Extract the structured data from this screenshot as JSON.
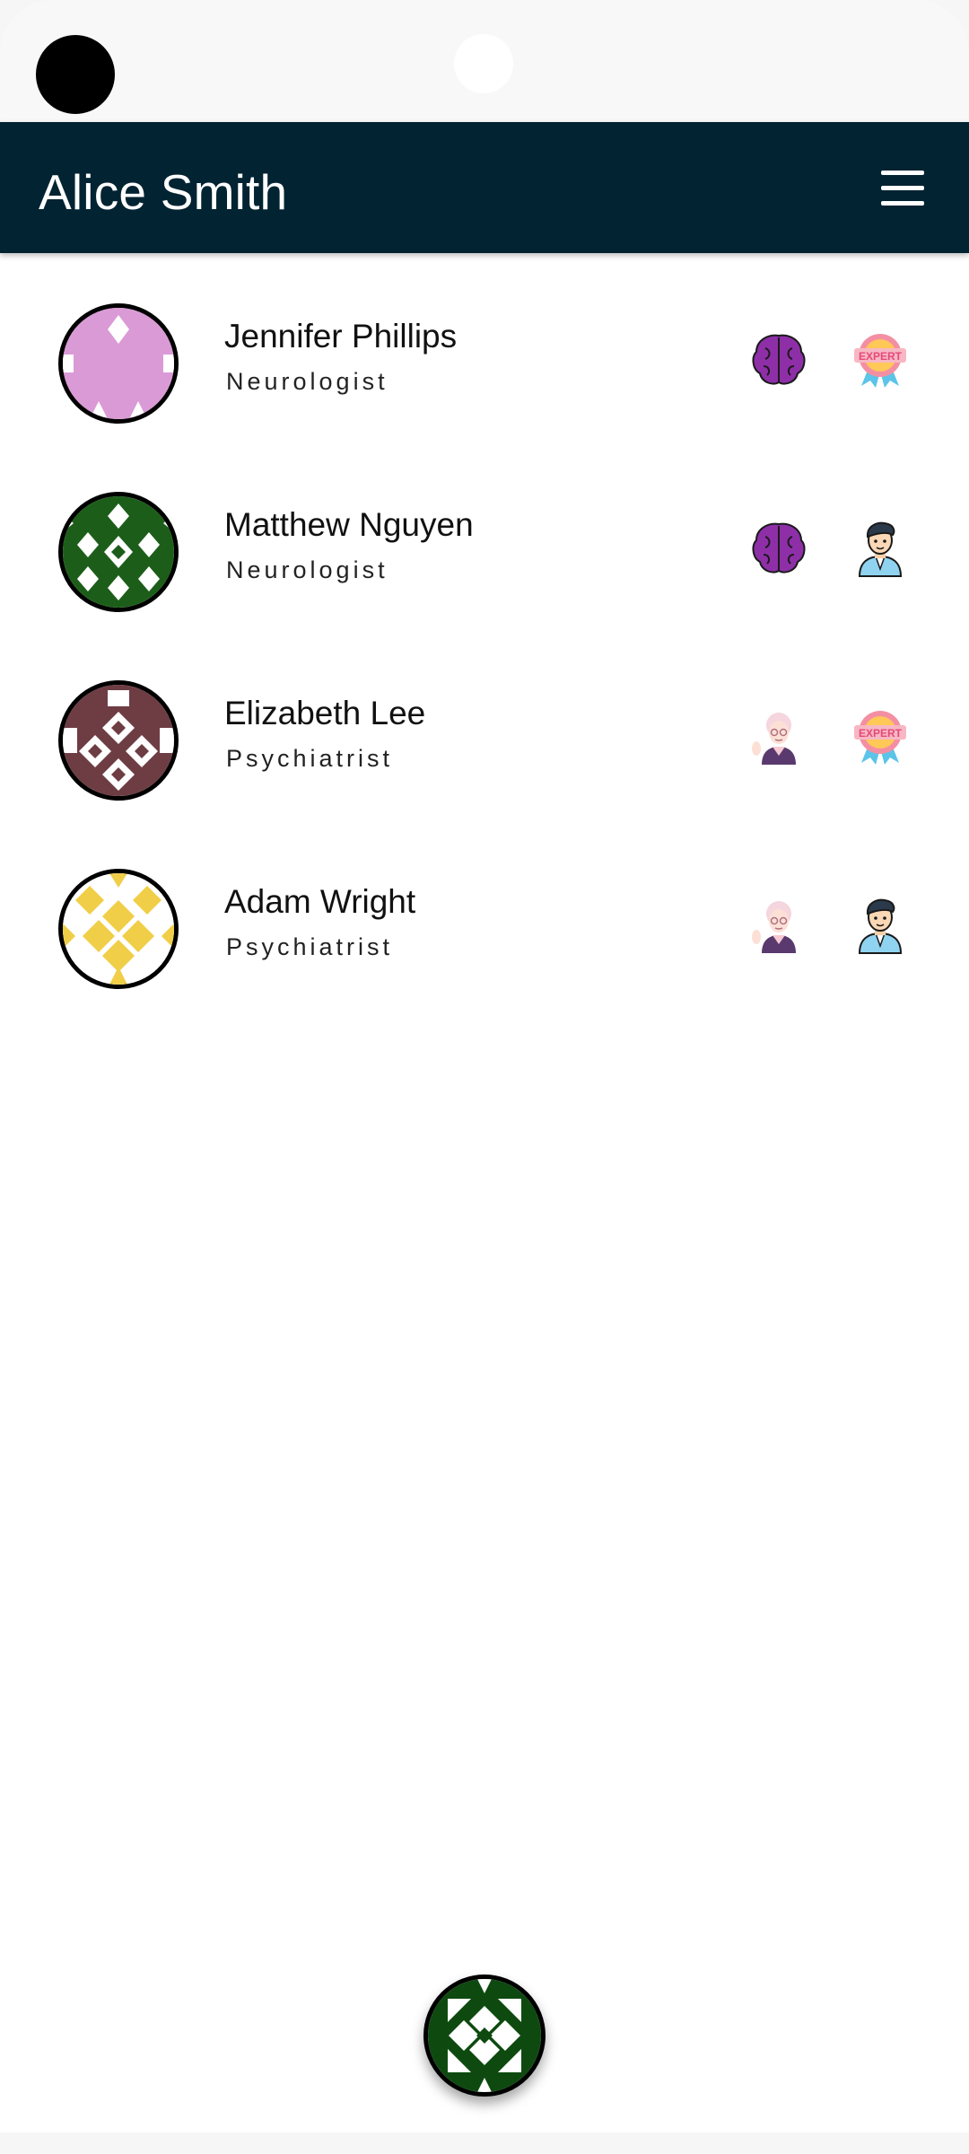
{
  "header": {
    "title": "Alice Smith"
  },
  "icons": {
    "menu": "hamburger-menu-icon",
    "brain": "brain-icon",
    "expert": "expert-badge-icon",
    "young_man": "young-man-icon",
    "grandma": "grandmother-icon"
  },
  "colors": {
    "appbar": "#022332",
    "avatar_1": "#DA9AD6",
    "avatar_2": "#1C5E19",
    "avatar_3": "#6D3D43",
    "avatar_4": "#F0CE47",
    "fab": "#0E4A10",
    "brain": "#8E2FA8"
  },
  "doctors": [
    {
      "name": "Jennifer Phillips",
      "role": "Neurologist",
      "badges": [
        "brain-icon",
        "expert-badge-icon"
      ]
    },
    {
      "name": "Matthew Nguyen",
      "role": "Neurologist",
      "badges": [
        "brain-icon",
        "young-man-icon"
      ]
    },
    {
      "name": "Elizabeth Lee",
      "role": "Psychiatrist",
      "badges": [
        "grandmother-icon",
        "expert-badge-icon"
      ]
    },
    {
      "name": "Adam Wright",
      "role": "Psychiatrist",
      "badges": [
        "grandmother-icon",
        "young-man-icon"
      ]
    }
  ],
  "badge_text": {
    "expert": "EXPERT"
  }
}
